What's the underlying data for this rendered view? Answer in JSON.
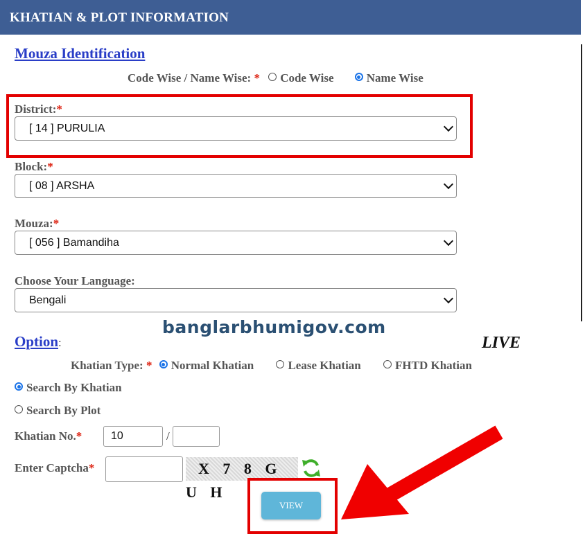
{
  "header": {
    "title": "KHATIAN & PLOT INFORMATION"
  },
  "mouza": {
    "section_title": "Mouza Identification",
    "mode_label": "Code Wise / Name Wise:",
    "mode_options": [
      "Code Wise",
      "Name Wise"
    ],
    "mode_selected": "Name Wise",
    "district_label": "District:",
    "district_value": "[ 14 ] PURULIA",
    "block_label": "Block:",
    "block_value": "[ 08 ] ARSHA",
    "mouza_label": "Mouza:",
    "mouza_value": "[ 056 ] Bamandiha",
    "language_label": "Choose Your Language:",
    "language_value": "Bengali"
  },
  "watermark": "banglarbhumigov.com",
  "live_text": "LIVE",
  "option": {
    "section_title": "Option",
    "colon": ":",
    "khatian_type_label": "Khatian Type:",
    "khatian_types": [
      "Normal Khatian",
      "Lease Khatian",
      "FHTD Khatian"
    ],
    "khatian_type_selected": "Normal Khatian",
    "search_by": [
      "Search By Khatian",
      "Search By Plot"
    ],
    "search_selected": "Search By Khatian",
    "khatian_no_label": "Khatian No.",
    "khatian_no_value": "10",
    "khatian_no_sep": "/",
    "khatian_no_value2": "",
    "captcha_label": "Enter Captcha",
    "captcha_value": "",
    "captcha_text": "X 7 8 G U H",
    "view_label": "VIEW"
  },
  "required_mark": "*",
  "colors": {
    "header_bg": "#3e5e94",
    "link": "#2a3ec7",
    "required": "#dd2211",
    "highlight": "#e30000",
    "button": "#5fb6d9"
  },
  "icons": [
    "chevron-down-icon",
    "refresh-icon",
    "arrow-pointer-icon"
  ]
}
